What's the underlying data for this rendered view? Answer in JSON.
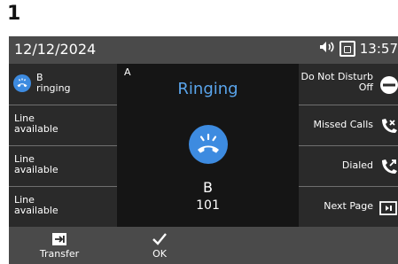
{
  "step_number": "1",
  "status": {
    "date": "12/12/2024",
    "time": "13:57"
  },
  "left_keys": [
    {
      "line1": "B",
      "line2": "ringing",
      "icon": "ringing-phone-icon"
    },
    {
      "line1": "Line",
      "line2": "available"
    },
    {
      "line1": "Line",
      "line2": "available"
    },
    {
      "line1": "Line",
      "line2": "available"
    }
  ],
  "right_keys": [
    {
      "line1": "Do Not Disturb",
      "line2": "Off",
      "icon": "do-not-disturb-icon"
    },
    {
      "line1": "Missed Calls",
      "icon": "missed-calls-icon"
    },
    {
      "line1": "Dialed",
      "icon": "dialed-calls-icon"
    },
    {
      "line1": "Next Page",
      "icon": "next-page-icon"
    }
  ],
  "call": {
    "line_label": "A",
    "state": "Ringing",
    "name": "B",
    "number": "101"
  },
  "softkeys": [
    {
      "label": "Transfer",
      "icon": "transfer-icon"
    },
    {
      "label": "OK",
      "icon": "check-icon"
    }
  ],
  "colors": {
    "accent": "#3d8be0",
    "ringing_text": "#5aa5ec",
    "screen_bg": "#2a2a2a",
    "bar_bg": "#4a4a4a"
  }
}
